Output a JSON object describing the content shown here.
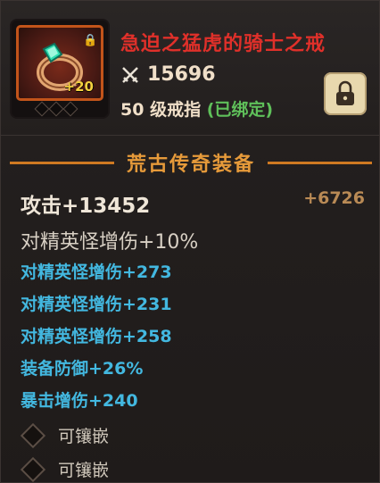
{
  "item": {
    "name": "急迫之猛虎的骑士之戒",
    "icon": "ring-icon",
    "enhance_level": "+20",
    "combat_power": "15696",
    "level": "50",
    "type": "级戒指",
    "bound": "(已绑定)"
  },
  "colors": {
    "name_red": "#e0302a",
    "title_orange": "#e69a3a",
    "extra_blue": "#43b8e0",
    "bound_green": "#5fc05a"
  },
  "section": {
    "title": "荒古传奇装备"
  },
  "stats": {
    "attack": "攻击+13452",
    "attack_bonus": "+6726",
    "elite_damage_pct": "对精英怪增伤+10%",
    "extras": [
      "对精英怪增伤+273",
      "对精英怪增伤+231",
      "对精英怪增伤+258",
      "装备防御+26%",
      "暴击增伤+240"
    ]
  },
  "sockets": [
    {
      "label": "可镶嵌"
    },
    {
      "label": "可镶嵌"
    }
  ]
}
